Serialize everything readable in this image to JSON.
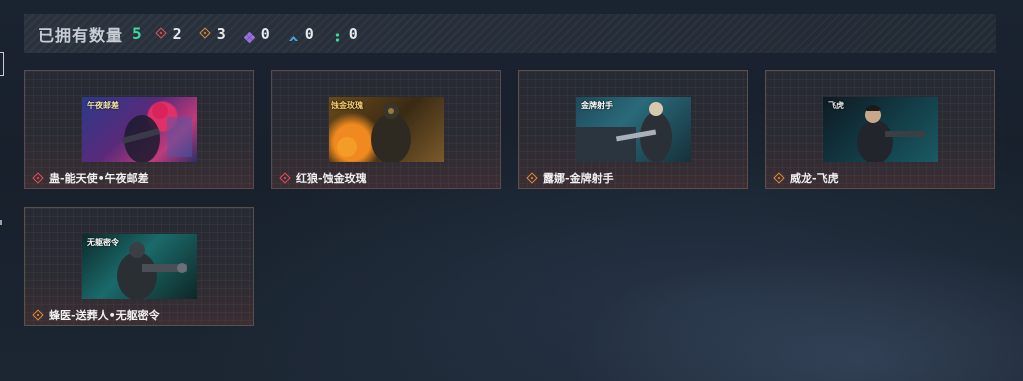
{
  "summary": {
    "label": "已拥有数量",
    "total": "5",
    "rarities": [
      {
        "icon": "red-diamond-icon",
        "color": "#e0505a",
        "count": "2"
      },
      {
        "icon": "orange-diamond-icon",
        "color": "#e08a3c",
        "count": "3"
      },
      {
        "icon": "purple-diamond-icon",
        "color": "#9a6fe0",
        "count": "0"
      },
      {
        "icon": "blue-chevron-icon",
        "color": "#4aa6e8",
        "count": "0"
      },
      {
        "icon": "green-dots-icon",
        "color": "#3fd6a0",
        "count": "0"
      }
    ]
  },
  "cards": [
    {
      "name": "蛊-能天使•午夜邮差",
      "rarity_color": "#e0505a",
      "thumb_title": "午夜邮差",
      "theme": "pink"
    },
    {
      "name": "红狼-蚀金玫瑰",
      "rarity_color": "#e0505a",
      "thumb_title": "蚀金玫瑰",
      "theme": "fire"
    },
    {
      "name": "露娜-金牌射手",
      "rarity_color": "#e08a3c",
      "thumb_title": "金牌射手",
      "theme": "teal"
    },
    {
      "name": "威龙-飞虎",
      "rarity_color": "#e08a3c",
      "thumb_title": "飞虎",
      "theme": "dark"
    },
    {
      "name": "蜂医-送葬人•无躯密令",
      "rarity_color": "#e08a3c",
      "thumb_title": "无躯密令",
      "theme": "green"
    }
  ]
}
